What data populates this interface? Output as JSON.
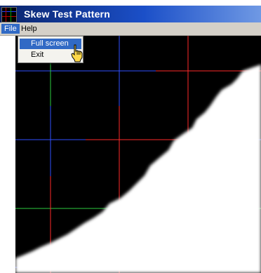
{
  "window": {
    "title": "Skew Test Pattern",
    "icon": "app-icon"
  },
  "menubar": {
    "items": [
      {
        "label": "File",
        "active": true
      },
      {
        "label": "Help",
        "active": false
      }
    ]
  },
  "file_menu": {
    "items": [
      {
        "label": "Full screen",
        "highlighted": true
      },
      {
        "label": "Exit",
        "highlighted": false
      }
    ]
  },
  "pattern": {
    "background": "#000000",
    "line_colors": {
      "red": "#ff2a2a",
      "green": "#2ecc40",
      "blue": "#3050ff"
    }
  },
  "cursor": "hand-pointer-icon"
}
